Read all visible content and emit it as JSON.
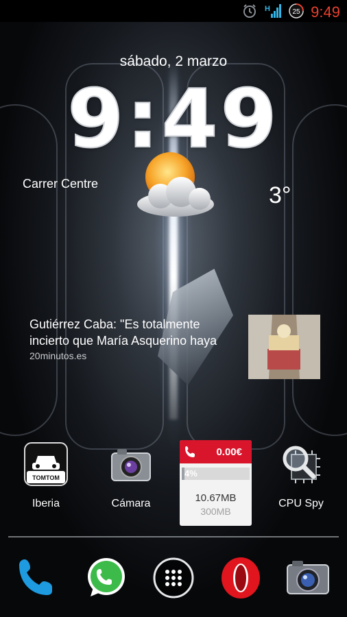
{
  "status_bar": {
    "time": "9:49",
    "notification_badge": "25",
    "icons": [
      "alarm-icon",
      "signal-icon",
      "notification-badge-icon"
    ]
  },
  "clock_widget": {
    "date": "sábado, 2 marzo",
    "time": "9:49",
    "location": "Carrer Centre",
    "temperature": "3°",
    "weather_icon": "partly-cloudy-icon"
  },
  "news_widget": {
    "headline": "Gutiérrez Caba: \"Es totalmente incierto que María Asquerino haya",
    "source": "20minutos.es"
  },
  "apps": [
    {
      "label": "Iberia",
      "icon": "tomtom-icon"
    },
    {
      "label": "Cámara",
      "icon": "camera-icon"
    },
    {
      "label": "CPU Spy",
      "icon": "cpu-spy-icon"
    }
  ],
  "data_widget": {
    "amount": "0.00€",
    "percent_label": "4%",
    "percent": 0.04,
    "used": "10.67MB",
    "total": "300MB"
  },
  "dock": [
    {
      "name": "phone",
      "icon": "phone-icon"
    },
    {
      "name": "whatsapp",
      "icon": "whatsapp-icon"
    },
    {
      "name": "app-drawer",
      "icon": "app-drawer-icon"
    },
    {
      "name": "opera",
      "icon": "opera-icon"
    },
    {
      "name": "camera",
      "icon": "camera-icon"
    }
  ],
  "colors": {
    "status_time": "#e8412f",
    "data_widget_header": "#d8152b",
    "signal": "#33b5e5"
  }
}
